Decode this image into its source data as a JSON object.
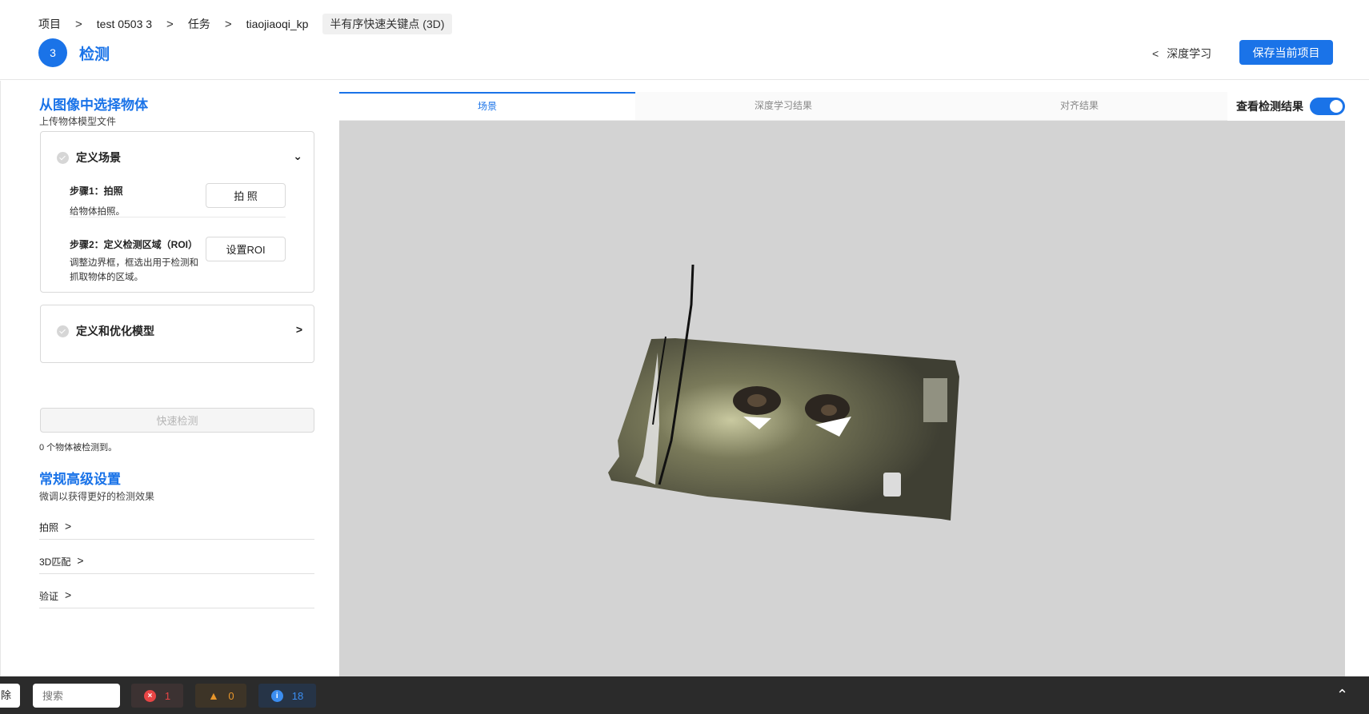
{
  "breadcrumb": {
    "items": [
      "项目",
      "test 0503 3",
      "任务",
      "tiaojiaoqi_kp"
    ],
    "current_tag": "半有序快速关键点 (3D)"
  },
  "header": {
    "step_number": "3",
    "step_title": "检测",
    "back_label": "深度学习",
    "save_label": "保存当前项目"
  },
  "left": {
    "select_title": "从图像中选择物体",
    "select_sub": "上传物体模型文件",
    "scene_card": {
      "title": "定义场景",
      "step1_label": "步骤1：拍照",
      "step1_desc": "给物体拍照。",
      "step1_btn": "拍 照",
      "step2_label": "步骤2：定义检测区域（ROI）",
      "step2_desc": "调整边界框，框选出用于检测和抓取物体的区域。",
      "step2_btn": "设置ROI"
    },
    "model_card": {
      "title": "定义和优化模型"
    },
    "quick_detect_label": "快速检测",
    "detect_count": "0 个物体被检测到。",
    "advanced_title": "常规高级设置",
    "advanced_sub": "微调以获得更好的检测效果",
    "advanced_items": [
      "拍照",
      "3D匹配",
      "验证"
    ]
  },
  "tabs": [
    "场景",
    "深度学习结果",
    "对齐结果"
  ],
  "view_toggle_label": "查看检测结果",
  "view_toggle_on": true,
  "footer": {
    "delete_label": "除",
    "search_placeholder": "搜索",
    "error_count": "1",
    "warning_count": "0",
    "info_count": "18"
  },
  "colors": {
    "accent": "#1a73e8",
    "error": "#e84545",
    "warning": "#e8962b",
    "info": "#3b8df0"
  }
}
